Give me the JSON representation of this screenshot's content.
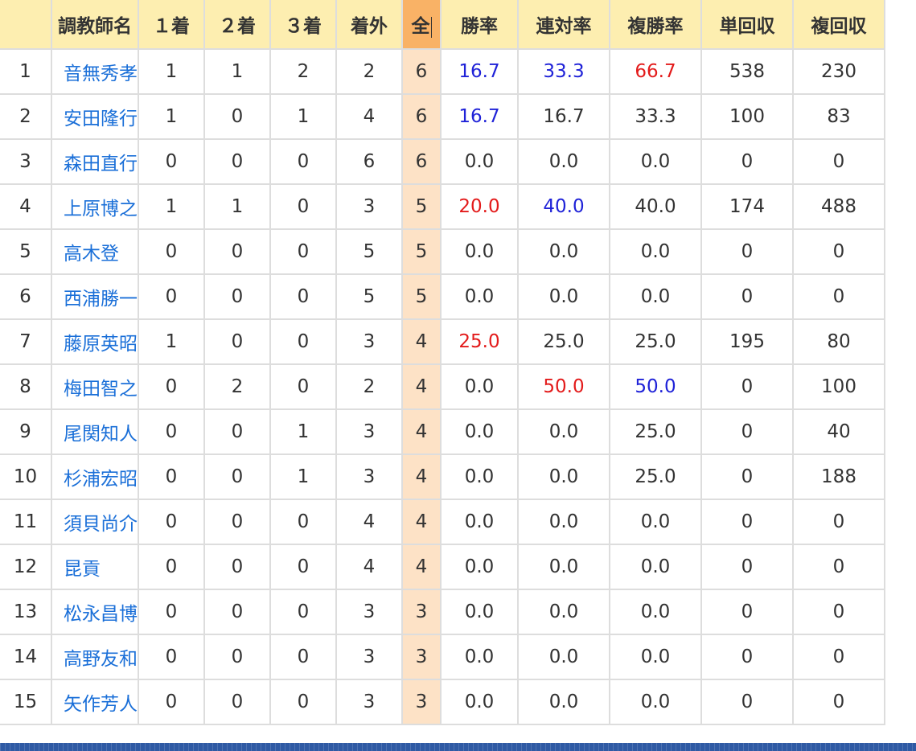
{
  "table": {
    "headers": [
      "",
      "調教師名",
      "１着",
      "２着",
      "３着",
      "着外",
      "全",
      "勝率",
      "連対率",
      "複勝率",
      "単回収",
      "複回収"
    ],
    "sorted_column": 6,
    "rows": [
      {
        "rank": "1",
        "name": "音無秀孝",
        "first": "1",
        "second": "1",
        "third": "2",
        "other": "2",
        "total": "6",
        "win_rate": "16.7",
        "quinella_rate": "33.3",
        "show_rate": "66.7",
        "win_return": "538",
        "show_return": "230"
      },
      {
        "rank": "2",
        "name": "安田隆行",
        "first": "1",
        "second": "0",
        "third": "1",
        "other": "4",
        "total": "6",
        "win_rate": "16.7",
        "quinella_rate": "16.7",
        "show_rate": "33.3",
        "win_return": "100",
        "show_return": "83"
      },
      {
        "rank": "3",
        "name": "森田直行",
        "first": "0",
        "second": "0",
        "third": "0",
        "other": "6",
        "total": "6",
        "win_rate": "0.0",
        "quinella_rate": "0.0",
        "show_rate": "0.0",
        "win_return": "0",
        "show_return": "0"
      },
      {
        "rank": "4",
        "name": "上原博之",
        "first": "1",
        "second": "1",
        "third": "0",
        "other": "3",
        "total": "5",
        "win_rate": "20.0",
        "quinella_rate": "40.0",
        "show_rate": "40.0",
        "win_return": "174",
        "show_return": "488"
      },
      {
        "rank": "5",
        "name": "高木登",
        "first": "0",
        "second": "0",
        "third": "0",
        "other": "5",
        "total": "5",
        "win_rate": "0.0",
        "quinella_rate": "0.0",
        "show_rate": "0.0",
        "win_return": "0",
        "show_return": "0"
      },
      {
        "rank": "6",
        "name": "西浦勝一",
        "first": "0",
        "second": "0",
        "third": "0",
        "other": "5",
        "total": "5",
        "win_rate": "0.0",
        "quinella_rate": "0.0",
        "show_rate": "0.0",
        "win_return": "0",
        "show_return": "0"
      },
      {
        "rank": "7",
        "name": "藤原英昭",
        "first": "1",
        "second": "0",
        "third": "0",
        "other": "3",
        "total": "4",
        "win_rate": "25.0",
        "quinella_rate": "25.0",
        "show_rate": "25.0",
        "win_return": "195",
        "show_return": "80"
      },
      {
        "rank": "8",
        "name": "梅田智之",
        "first": "0",
        "second": "2",
        "third": "0",
        "other": "2",
        "total": "4",
        "win_rate": "0.0",
        "quinella_rate": "50.0",
        "show_rate": "50.0",
        "win_return": "0",
        "show_return": "100"
      },
      {
        "rank": "9",
        "name": "尾関知人",
        "first": "0",
        "second": "0",
        "third": "1",
        "other": "3",
        "total": "4",
        "win_rate": "0.0",
        "quinella_rate": "0.0",
        "show_rate": "25.0",
        "win_return": "0",
        "show_return": "40"
      },
      {
        "rank": "10",
        "name": "杉浦宏昭",
        "first": "0",
        "second": "0",
        "third": "1",
        "other": "3",
        "total": "4",
        "win_rate": "0.0",
        "quinella_rate": "0.0",
        "show_rate": "25.0",
        "win_return": "0",
        "show_return": "188"
      },
      {
        "rank": "11",
        "name": "須貝尚介",
        "first": "0",
        "second": "0",
        "third": "0",
        "other": "4",
        "total": "4",
        "win_rate": "0.0",
        "quinella_rate": "0.0",
        "show_rate": "0.0",
        "win_return": "0",
        "show_return": "0"
      },
      {
        "rank": "12",
        "name": "昆貢",
        "first": "0",
        "second": "0",
        "third": "0",
        "other": "4",
        "total": "4",
        "win_rate": "0.0",
        "quinella_rate": "0.0",
        "show_rate": "0.0",
        "win_return": "0",
        "show_return": "0"
      },
      {
        "rank": "13",
        "name": "松永昌博",
        "first": "0",
        "second": "0",
        "third": "0",
        "other": "3",
        "total": "3",
        "win_rate": "0.0",
        "quinella_rate": "0.0",
        "show_rate": "0.0",
        "win_return": "0",
        "show_return": "0"
      },
      {
        "rank": "14",
        "name": "高野友和",
        "first": "0",
        "second": "0",
        "third": "0",
        "other": "3",
        "total": "3",
        "win_rate": "0.0",
        "quinella_rate": "0.0",
        "show_rate": "0.0",
        "win_return": "0",
        "show_return": "0"
      },
      {
        "rank": "15",
        "name": "矢作芳人",
        "first": "0",
        "second": "0",
        "third": "0",
        "other": "3",
        "total": "3",
        "win_rate": "0.0",
        "quinella_rate": "0.0",
        "show_rate": "0.0",
        "win_return": "0",
        "show_return": "0"
      }
    ]
  },
  "highlights": {
    "0": {
      "win_rate": "blue",
      "quinella_rate": "blue",
      "show_rate": "red"
    },
    "1": {
      "win_rate": "blue"
    },
    "3": {
      "win_rate": "red",
      "quinella_rate": "blue"
    },
    "6": {
      "win_rate": "red"
    },
    "7": {
      "quinella_rate": "red",
      "show_rate": "blue"
    }
  },
  "colors": {
    "header_bg": "#fdeeb0",
    "sorted_header_bg": "#f9b266",
    "sorted_cell_bg": "#fde2c6",
    "link": "#1a6fd8",
    "highlight_red": "#e31b1b",
    "highlight_blue": "#1f22d8",
    "border": "#dddddd"
  }
}
